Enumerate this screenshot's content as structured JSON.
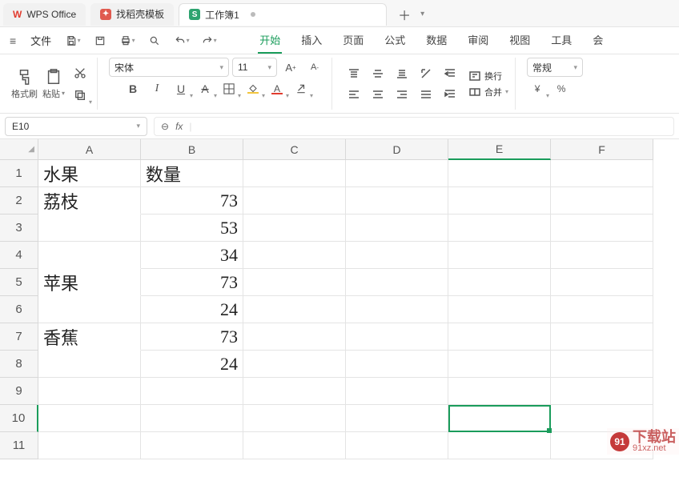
{
  "tabs": {
    "app": "WPS Office",
    "template": "找稻壳模板",
    "workbook": "工作簿1"
  },
  "menu": {
    "file": "文件",
    "start": "开始",
    "insert": "插入",
    "page": "页面",
    "formula": "公式",
    "data": "数据",
    "review": "审阅",
    "view": "视图",
    "tools": "工具",
    "member": "会"
  },
  "ribbon": {
    "format_painter": "格式刷",
    "paste": "粘贴",
    "font_name": "宋体",
    "font_size": "11",
    "wrap": "换行",
    "merge": "合并",
    "normal": "常规"
  },
  "name_box": "E10",
  "fx_label": "fx",
  "columns": [
    "A",
    "B",
    "C",
    "D",
    "E",
    "F"
  ],
  "rows": [
    "1",
    "2",
    "3",
    "4",
    "5",
    "6",
    "7",
    "8",
    "9",
    "10",
    "11"
  ],
  "cells": {
    "A1": "水果",
    "B1": "数量",
    "A2": "荔枝",
    "B2": "73",
    "B3": "53",
    "A4": "苹果",
    "B4": "34",
    "B5": "73",
    "B6": "24",
    "A7": "香蕉",
    "B7": "73",
    "B8": "24"
  },
  "merges": {
    "A2": 2,
    "A4": 3,
    "A7": 2
  },
  "active_cell": "E10",
  "watermark": {
    "brand": "下载站",
    "url": "91xz.net",
    "badge": "91"
  }
}
